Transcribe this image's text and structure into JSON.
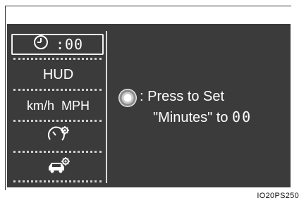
{
  "sidebar": {
    "items": [
      {
        "label": ":00",
        "icon": "clock-icon",
        "selected": true
      },
      {
        "label": "HUD"
      },
      {
        "label": "km/h  MPH"
      },
      {
        "icon": "gauge-settings-icon"
      },
      {
        "icon": "vehicle-settings-icon"
      }
    ]
  },
  "main": {
    "knob_icon": "control-knob-icon",
    "line1": ": Press to Set",
    "line2_prefix": "\"Minutes\" to ",
    "line2_digits": "00"
  },
  "figure_code": "IO20PS250"
}
